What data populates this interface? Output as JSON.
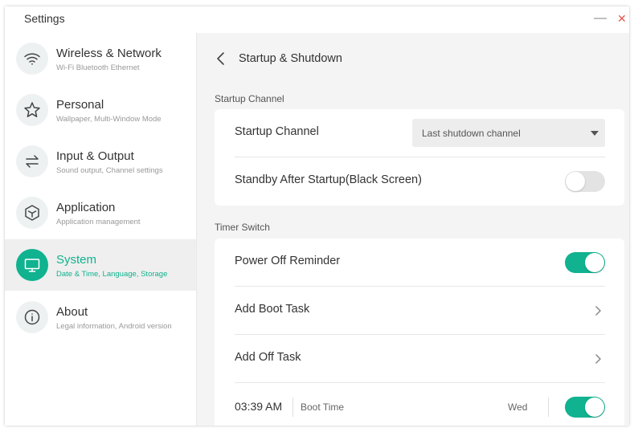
{
  "window": {
    "title": "Settings",
    "minimize_glyph": "—",
    "close_glyph": "✕"
  },
  "sidebar": {
    "items": [
      {
        "title": "Wireless & Network",
        "subtitle": "Wi-Fi Bluetooth Ethernet",
        "icon": "wifi-icon"
      },
      {
        "title": "Personal",
        "subtitle": "Wallpaper, Multi-Window Mode",
        "icon": "star-icon"
      },
      {
        "title": "Input & Output",
        "subtitle": "Sound output, Channel settings",
        "icon": "swap-arrows-icon"
      },
      {
        "title": "Application",
        "subtitle": "Application management",
        "icon": "cube-icon"
      },
      {
        "title": "System",
        "subtitle": "Date & Time, Language, Storage",
        "icon": "monitor-icon",
        "active": true
      },
      {
        "title": "About",
        "subtitle": "Legal information, Android version",
        "icon": "info-icon"
      }
    ]
  },
  "page": {
    "title": "Startup & Shutdown",
    "startup_section": {
      "label": "Startup Channel",
      "channel_label": "Startup Channel",
      "channel_value": "Last shutdown channel",
      "standby_label": "Standby After Startup(Black Screen)",
      "standby_on": false
    },
    "timer_section": {
      "label": "Timer Switch",
      "reminder_label": "Power Off Reminder",
      "reminder_on": true,
      "add_boot_label": "Add Boot Task",
      "add_off_label": "Add Off Task",
      "tasks": [
        {
          "time": "03:39 AM",
          "type": "Boot Time",
          "days": "Wed",
          "enabled": true
        }
      ]
    }
  },
  "colors": {
    "accent": "#10b28f",
    "sidebar_active_bg": "#efefef",
    "content_bg": "#f4f4f4",
    "close_red": "#e4584f"
  }
}
